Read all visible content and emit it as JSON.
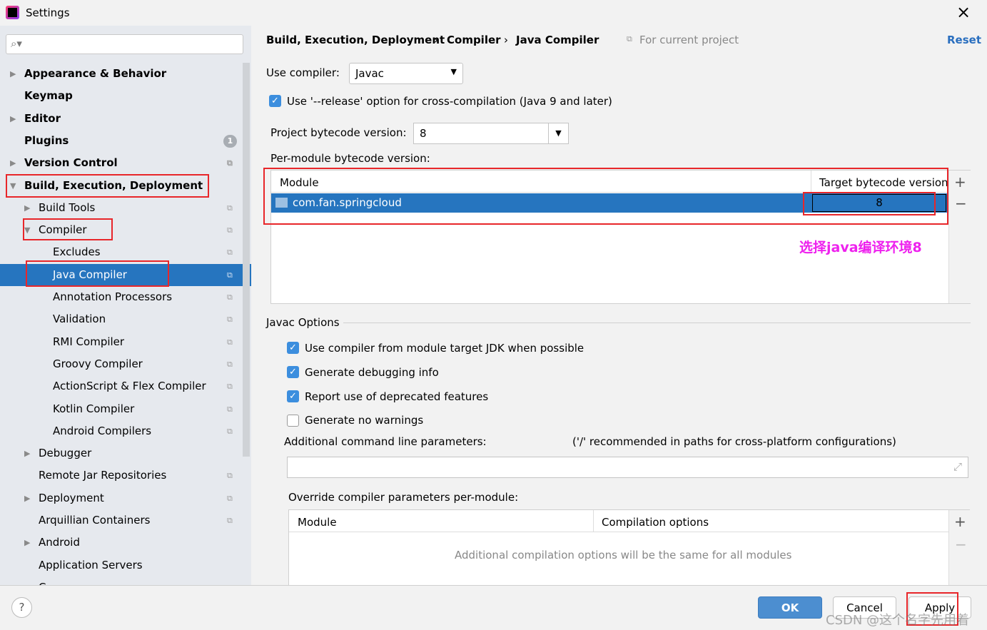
{
  "window": {
    "title": "Settings",
    "close_icon": "×"
  },
  "sidebar": {
    "search_placeholder": "",
    "items": [
      {
        "label": "Appearance & Behavior",
        "level": 0,
        "bold": true,
        "arrow": "right"
      },
      {
        "label": "Keymap",
        "level": 0,
        "bold": true
      },
      {
        "label": "Editor",
        "level": 0,
        "bold": true,
        "arrow": "right"
      },
      {
        "label": "Plugins",
        "level": 0,
        "bold": true,
        "badge": "1"
      },
      {
        "label": "Version Control",
        "level": 0,
        "bold": true,
        "arrow": "right",
        "copy": true
      },
      {
        "label": "Build, Execution, Deployment",
        "level": 0,
        "bold": true,
        "arrow": "down"
      },
      {
        "label": "Build Tools",
        "level": 1,
        "arrow": "right",
        "copy": true
      },
      {
        "label": "Compiler",
        "level": 1,
        "arrow": "down",
        "copy": true
      },
      {
        "label": "Excludes",
        "level": 2,
        "copy": true
      },
      {
        "label": "Java Compiler",
        "level": 2,
        "copy": true,
        "selected": true
      },
      {
        "label": "Annotation Processors",
        "level": 2,
        "copy": true
      },
      {
        "label": "Validation",
        "level": 2,
        "copy": true
      },
      {
        "label": "RMI Compiler",
        "level": 2,
        "copy": true
      },
      {
        "label": "Groovy Compiler",
        "level": 2,
        "copy": true
      },
      {
        "label": "ActionScript & Flex Compiler",
        "level": 2,
        "copy": true
      },
      {
        "label": "Kotlin Compiler",
        "level": 2,
        "copy": true
      },
      {
        "label": "Android Compilers",
        "level": 2,
        "copy": true
      },
      {
        "label": "Debugger",
        "level": 1,
        "arrow": "right"
      },
      {
        "label": "Remote Jar Repositories",
        "level": 1,
        "copy": true
      },
      {
        "label": "Deployment",
        "level": 1,
        "arrow": "right",
        "copy": true
      },
      {
        "label": "Arquillian Containers",
        "level": 1,
        "copy": true
      },
      {
        "label": "Android",
        "level": 1,
        "arrow": "right"
      },
      {
        "label": "Application Servers",
        "level": 1
      },
      {
        "label": "C",
        "level": 1,
        "copy": true
      }
    ]
  },
  "breadcrumb": {
    "items": [
      "Build, Execution, Deployment",
      "Compiler",
      "Java Compiler"
    ],
    "scope": "For current project",
    "reset": "Reset"
  },
  "compiler": {
    "label": "Use compiler:",
    "value": "Javac"
  },
  "release_option": {
    "label": "Use '--release' option for cross-compilation (Java 9 and later)",
    "checked": true
  },
  "bytecode": {
    "label": "Project bytecode version:",
    "value": "8"
  },
  "per_module": {
    "label": "Per-module bytecode version:",
    "columns": [
      "Module",
      "Target bytecode version"
    ],
    "rows": [
      {
        "module": "com.fan.springcloud",
        "version": "8"
      }
    ],
    "annotation": "选择java编译环境8",
    "annotation_color": "#ee22ee"
  },
  "javac": {
    "section": "Javac Options",
    "options": [
      {
        "label": "Use compiler from module target JDK when possible",
        "checked": true
      },
      {
        "label": "Generate debugging info",
        "checked": true
      },
      {
        "label": "Report use of deprecated features",
        "checked": true
      },
      {
        "label": "Generate no warnings",
        "checked": false
      }
    ],
    "cmd_label": "Additional command line parameters:",
    "cmd_hint": "('/' recommended in paths for cross-platform configurations)",
    "cmd_value": "",
    "override_label": "Override compiler parameters per-module:",
    "override_columns": [
      "Module",
      "Compilation options"
    ],
    "override_empty": "Additional compilation options will be the same for all modules"
  },
  "footer": {
    "help": "?",
    "ok": "OK",
    "cancel": "Cancel",
    "apply": "Apply",
    "watermark": "CSDN @这个名字先用着"
  },
  "colors": {
    "accent": "#2675bf",
    "highlight": "#e8262a"
  }
}
